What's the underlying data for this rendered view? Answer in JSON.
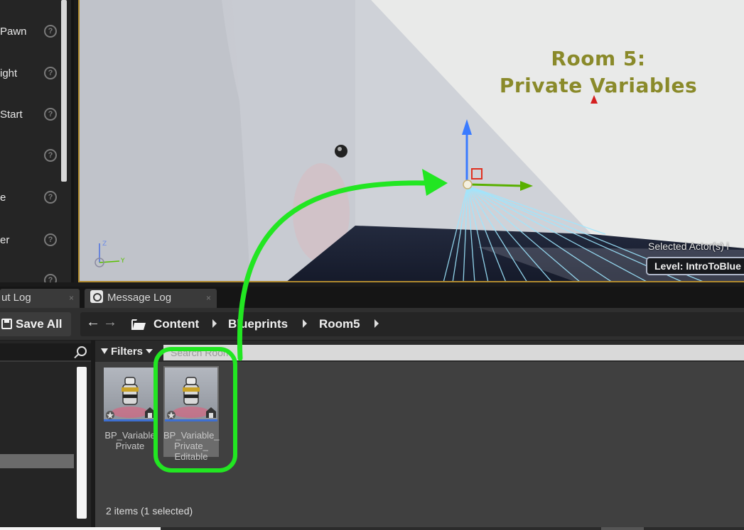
{
  "place_actors": {
    "items": [
      {
        "label": "Pawn"
      },
      {
        "label": "ight"
      },
      {
        "label": "Start"
      },
      {
        "label": ""
      },
      {
        "label": "e"
      },
      {
        "label": "er"
      }
    ],
    "help_icon": "?"
  },
  "viewport": {
    "room_title_line1": "Room 5:",
    "room_title_line2": "Private Variables",
    "selected_actors": "Selected Actor(s) i",
    "level_label": "Level:",
    "level_value": "IntroToBlue",
    "axis_z": "Z",
    "axis_y": "Y"
  },
  "tabs": [
    {
      "label": "ut Log",
      "close": "×"
    },
    {
      "label": "Message Log",
      "close": "×"
    }
  ],
  "toolbar": {
    "save_all_label": "Save All",
    "back_icon": "arrow-left-icon",
    "forward_icon": "arrow-right-icon",
    "breadcrumb": [
      "Content",
      "Blueprints",
      "Room5"
    ]
  },
  "assets": {
    "filters_label": "Filters",
    "search_placeholder": "Search Room",
    "items": [
      {
        "name": "BP_Variable\nPrivate",
        "selected": false
      },
      {
        "name": "BP_Variable_\nPrivate_\nEditable",
        "selected": true
      }
    ],
    "status": "2 items (1 selected)"
  },
  "colors": {
    "highlight": "#22e622",
    "selection_border": "#b08a2e",
    "title_text": "#8a8a2a"
  }
}
